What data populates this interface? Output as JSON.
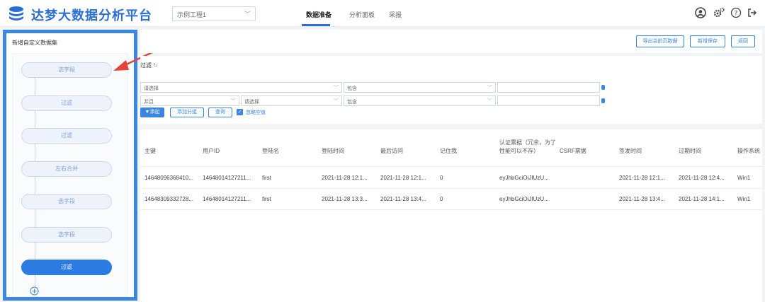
{
  "header": {
    "brand": "达梦大数据分析平台",
    "project_select": "示例工程1",
    "tabs": [
      "数据准备",
      "分析面板",
      "采报"
    ],
    "active_tab": 0
  },
  "left_panel": {
    "title": "新增自定义数据集",
    "nodes": [
      {
        "label": "选字段",
        "active": false
      },
      {
        "label": "过滤",
        "active": false
      },
      {
        "label": "过滤",
        "active": false
      },
      {
        "label": "左右合并",
        "active": false
      },
      {
        "label": "选字段",
        "active": false
      },
      {
        "label": "选字段",
        "active": false
      },
      {
        "label": "过滤",
        "active": true
      }
    ]
  },
  "toolbar": {
    "buttons": [
      "导出当前页数据",
      "新增保存",
      "返回"
    ]
  },
  "filter": {
    "title": "过滤",
    "row1": {
      "field": "请选择",
      "op": "包含",
      "value": ""
    },
    "row2": {
      "logic": "并且",
      "field": "请选择",
      "op": "包含",
      "value": ""
    },
    "buttons": [
      "▼添加",
      "添加分组",
      "查询"
    ],
    "checkbox_label": "忽略空值",
    "checkbox_checked": true
  },
  "table": {
    "columns": [
      "主键",
      "用户ID",
      "登陆名",
      "登陆时间",
      "最后访问",
      "记住我",
      "认证票据（冗余，为了性能可以不存）",
      "CSRF票据",
      "签发时间",
      "过期时间",
      "操作系统"
    ],
    "rows": [
      [
        "14648096368410...",
        "14648014127211...",
        "first",
        "2021-11-28 12:1...",
        "2021-11-28 12:1...",
        "0",
        "eyJhbGciOiJIUzU...",
        "",
        "2021-11-28 12:1...",
        "2021-11-28 12:4...",
        "Win1"
      ],
      [
        "14648309332728...",
        "14648014127211...",
        "first",
        "2021-11-28 13:3...",
        "2021-11-28 13:4...",
        "0",
        "eyJhbGciOiJIUzU...",
        "",
        "2021-11-28 13:4...",
        "2021-11-28 14:1...",
        "Win1"
      ]
    ]
  },
  "colors": {
    "accent": "#2b6fd6",
    "panel_border": "#3a86e0",
    "annotation_arrow": "#e8413a"
  },
  "icons": [
    "logo-icon",
    "user-icon",
    "settings-icon",
    "help-icon",
    "logout-icon",
    "plus-circle-icon",
    "annotation-arrow"
  ]
}
